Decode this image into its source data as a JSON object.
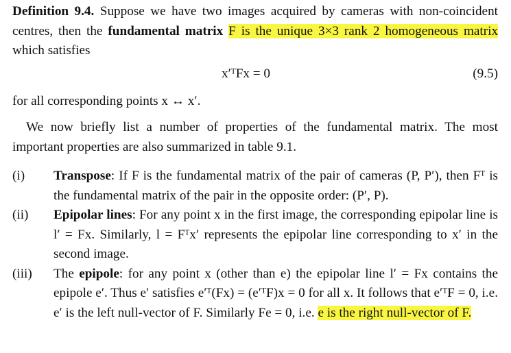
{
  "definition": {
    "label": "Definition 9.4.",
    "intro": "Suppose we have two images acquired by cameras with non-coincident centres, then the",
    "term": "fundamental matrix",
    "highlighted": "F is the unique 3×3 rank 2 homogeneous matrix",
    "tail": "which satisfies"
  },
  "equation": {
    "text": "x′ᵀFx = 0",
    "number": "(9.5)"
  },
  "after_equation": "for all corresponding points x ↔ x′.",
  "paragraph": "We now briefly list a number of properties of the fundamental matrix. The most important properties are also summarized in table 9.1.",
  "items": [
    {
      "label": "(i)",
      "title": "Transpose",
      "text": ": If F is the fundamental matrix of the pair of cameras (P, P′), then Fᵀ is the fundamental matrix of the pair in the opposite order: (P′, P)."
    },
    {
      "label": "(ii)",
      "title": "Epipolar lines",
      "text": ": For any point x in the first image, the corresponding epipolar line is l′ = Fx. Similarly, l = Fᵀx′ represents the epipolar line corresponding to x′ in the second image."
    },
    {
      "label": "(iii)",
      "pre": "The ",
      "title": "epipole",
      "text": ": for any point x (other than e) the epipolar line l′ = Fx contains the epipole e′. Thus e′ satisfies e′ᵀ(Fx) = (e′ᵀF)x = 0 for all x. It follows that e′ᵀF = 0, i.e. e′ is the left null-vector of F. Similarly Fe = 0, i.e.",
      "highlighted": "e is the right null-vector of F."
    }
  ]
}
